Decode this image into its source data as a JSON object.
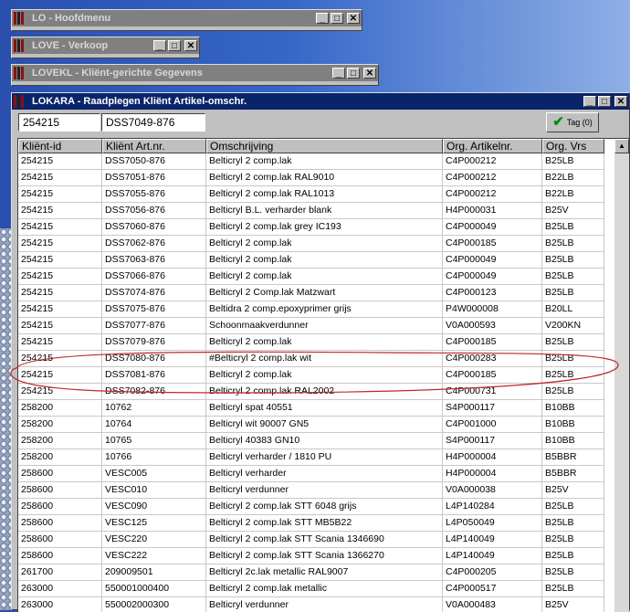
{
  "windows": {
    "lo": {
      "title": "LO - Hoofdmenu"
    },
    "love": {
      "title": "LOVE - Verkoop"
    },
    "lovekl": {
      "title": "LOVEKL - Kliënt-gerichte Gegevens"
    },
    "lokara": {
      "title": "LOKARA - Raadplegen Kliënt Artikel-omschr."
    }
  },
  "filters": {
    "client_id": "254215",
    "client_art": "DSS7049-876"
  },
  "tag_button": {
    "label": "Tag (0)",
    "icon": "checkmark-icon"
  },
  "table": {
    "columns": [
      "Kliënt-id",
      "Kliënt Art.nr.",
      "Omschrijving",
      "Org. Artikelnr.",
      "Org. Vrs"
    ],
    "rows": [
      [
        "254215",
        "DSS7050-876",
        "Belticryl 2 comp.lak",
        "C4P000212",
        "B25LB"
      ],
      [
        "254215",
        "DSS7051-876",
        "Belticryl 2 comp.lak RAL9010",
        "C4P000212",
        "B22LB"
      ],
      [
        "254215",
        "DSS7055-876",
        "Belticryl 2 comp.lak RAL1013",
        "C4P000212",
        "B22LB"
      ],
      [
        "254215",
        "DSS7056-876",
        "Belticryl B.L. verharder blank",
        "H4P000031",
        "B25V"
      ],
      [
        "254215",
        "DSS7060-876",
        "Belticryl 2 comp.lak grey IC193",
        "C4P000049",
        "B25LB"
      ],
      [
        "254215",
        "DSS7062-876",
        "Belticryl 2 comp.lak",
        "C4P000185",
        "B25LB"
      ],
      [
        "254215",
        "DSS7063-876",
        "Belticryl 2 comp.lak",
        "C4P000049",
        "B25LB"
      ],
      [
        "254215",
        "DSS7066-876",
        "Belticryl 2 comp.lak",
        "C4P000049",
        "B25LB"
      ],
      [
        "254215",
        "DSS7074-876",
        "Belticryl 2 Comp.lak Matzwart",
        "C4P000123",
        "B25LB"
      ],
      [
        "254215",
        "DSS7075-876",
        "Beltidra 2 comp.epoxyprimer grijs",
        "P4W000008",
        "B20LL"
      ],
      [
        "254215",
        "DSS7077-876",
        "Schoonmaakverdunner",
        "V0A000593",
        "V200KN"
      ],
      [
        "254215",
        "DSS7079-876",
        "Belticryl 2 comp.lak",
        "C4P000185",
        "B25LB"
      ],
      [
        "254215",
        "DSS7080-876",
        "#Belticryl 2 comp.lak wit",
        "C4P000283",
        "B25LB"
      ],
      [
        "254215",
        "DSS7081-876",
        "Belticryl 2 comp.lak",
        "C4P000185",
        "B25LB"
      ],
      [
        "254215",
        "DSS7082-876",
        "Belticryl 2 comp.lak RAL2002",
        "C4P000731",
        "B25LB"
      ],
      [
        "258200",
        "10762",
        "Belticryl spat 40551",
        "S4P000117",
        "B10BB"
      ],
      [
        "258200",
        "10764",
        "Belticryl wit 90007 GN5",
        "C4P001000",
        "B10BB"
      ],
      [
        "258200",
        "10765",
        "Belticryl 40383 GN10",
        "S4P000117",
        "B10BB"
      ],
      [
        "258200",
        "10766",
        "Belticryl verharder / 1810 PU",
        "H4P000004",
        "B5BBR"
      ],
      [
        "258600",
        "VESC005",
        "Belticryl verharder",
        "H4P000004",
        "B5BBR"
      ],
      [
        "258600",
        "VESC010",
        "Belticryl verdunner",
        "V0A000038",
        "B25V"
      ],
      [
        "258600",
        "VESC090",
        "Belticryl 2 comp.lak STT 6048 grijs",
        "L4P140284",
        "B25LB"
      ],
      [
        "258600",
        "VESC125",
        "Belticryl 2 comp.lak STT MB5B22",
        "L4P050049",
        "B25LB"
      ],
      [
        "258600",
        "VESC220",
        "Belticryl 2 comp.lak STT Scania 1346690",
        "L4P140049",
        "B25LB"
      ],
      [
        "258600",
        "VESC222",
        "Belticryl 2 comp.lak STT Scania 1366270",
        "L4P140049",
        "B25LB"
      ],
      [
        "261700",
        "209009501",
        "Belticryl 2c.lak metallic RAL9007",
        "C4P000205",
        "B25LB"
      ],
      [
        "263000",
        "550001000400",
        "Belticryl 2 comp.lak metallic",
        "C4P000517",
        "B25LB"
      ],
      [
        "263000",
        "550002000300",
        "Belticryl verdunner",
        "V0A000483",
        "B25V"
      ]
    ]
  },
  "annotation": {
    "color": "#c0282a"
  }
}
